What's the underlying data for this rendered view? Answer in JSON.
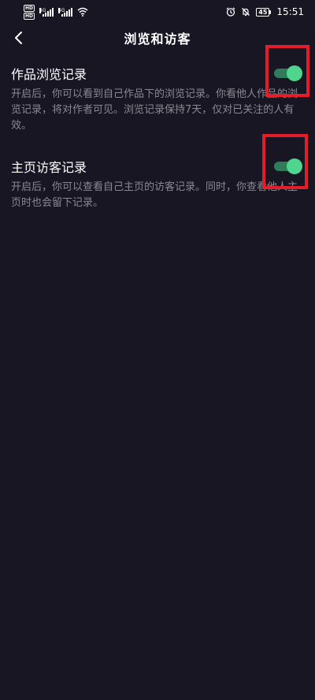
{
  "status_bar": {
    "sim1_tag": "HD",
    "sim2_tag": "HD",
    "sim1_label": "4G",
    "sim2_label": "4G",
    "battery": "45",
    "time": "15:51",
    "icons": [
      "alarm-icon",
      "mute-icon",
      "battery-icon",
      "wifi-icon",
      "signal-icon"
    ]
  },
  "header": {
    "title": "浏览和访客",
    "back_icon": "chevron-left-icon"
  },
  "settings": [
    {
      "title": "作品浏览记录",
      "description": "开启后，你可以看到自己作品下的浏览记录。你看他人作品的浏览记录，将对作者可见。浏览记录保持7天，仅对已关注的人有效。",
      "enabled": true
    },
    {
      "title": "主页访客记录",
      "description": "开启后，你可以查看自己主页的访客记录。同时，你查看他人主页时也会留下记录。",
      "enabled": true
    }
  ],
  "colors": {
    "background": "#171622",
    "toggle_on_track": "#2f7c5b",
    "toggle_on_knob": "#4fd58e",
    "highlight": "#e51d2b",
    "description_text": "#8a8993"
  }
}
